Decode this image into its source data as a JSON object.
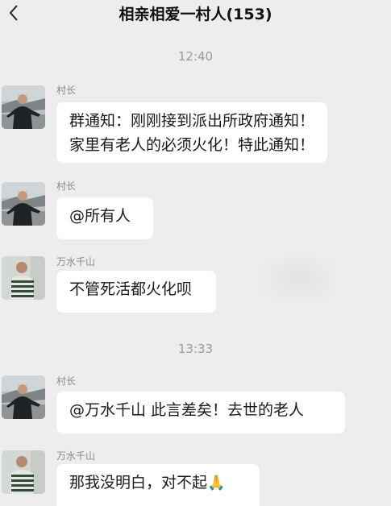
{
  "header": {
    "title": "相亲相爱一村人(153)"
  },
  "messages": {
    "time_1": "12:40",
    "msg1": {
      "sender": "村长",
      "line1": "群通知：刚刚接到派出所政府通知！",
      "line2": "家里有老人的必须火化！特此通知！"
    },
    "msg2": {
      "sender": "村长",
      "text": "@所有人"
    },
    "msg3": {
      "sender": "万水千山",
      "text": "不管死活都火化呗"
    },
    "time_2": "13:33",
    "msg4": {
      "sender": "村长",
      "text": "@万水千山 此言差矣！去世的老人"
    },
    "msg5": {
      "sender": "万水千山",
      "text": "那我没明白，对不起",
      "emoji": "🙏"
    }
  },
  "colors": {
    "background": "#ededed",
    "bubble": "#ffffff",
    "time_text": "#9a9a9a",
    "sender_text": "#8a8a8a"
  },
  "icons": {
    "back": "chevron-left-icon",
    "pray_emoji": "folded-hands-icon"
  }
}
